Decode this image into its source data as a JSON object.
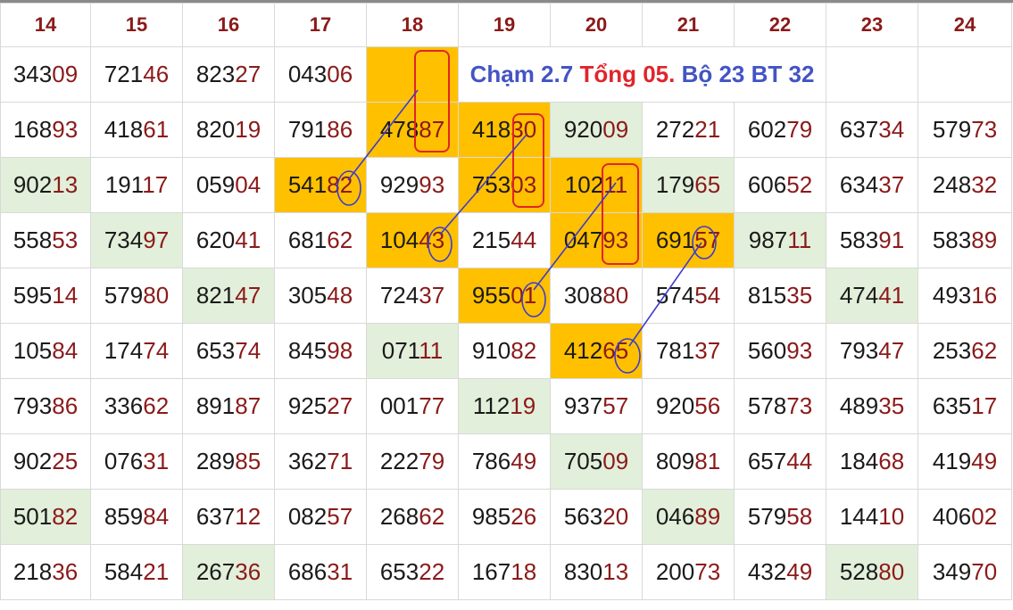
{
  "headers": [
    "14",
    "15",
    "16",
    "17",
    "18",
    "19",
    "20",
    "21",
    "22",
    "23",
    "24"
  ],
  "title": {
    "part1": "Chạm 2.7",
    "part2": "Tổng 05.",
    "part3": "Bộ 23 BT 32"
  },
  "rows": [
    [
      {
        "h": "343",
        "t": "09"
      },
      {
        "h": "721",
        "t": "46"
      },
      {
        "h": "823",
        "t": "27"
      },
      {
        "h": "043",
        "t": "06"
      },
      {
        "h": "",
        "t": "",
        "c": "o"
      },
      {
        "title": true
      },
      null,
      null,
      null,
      {
        "h": "",
        "t": ""
      },
      {
        "h": "",
        "t": ""
      }
    ],
    [
      {
        "h": "168",
        "t": "93"
      },
      {
        "h": "418",
        "t": "61"
      },
      {
        "h": "820",
        "t": "19"
      },
      {
        "h": "791",
        "t": "86"
      },
      {
        "h": "478",
        "t": "87",
        "c": "o"
      },
      {
        "h": "418",
        "t": "30",
        "c": "o"
      },
      {
        "h": "920",
        "t": "09",
        "c": "g"
      },
      {
        "h": "272",
        "t": "21"
      },
      {
        "h": "602",
        "t": "79"
      },
      {
        "h": "637",
        "t": "34"
      },
      {
        "h": "579",
        "t": "73"
      }
    ],
    [
      {
        "h": "902",
        "t": "13",
        "c": "g"
      },
      {
        "h": "191",
        "t": "17"
      },
      {
        "h": "059",
        "t": "04"
      },
      {
        "h": "541",
        "t": "82",
        "c": "o"
      },
      {
        "h": "929",
        "t": "93"
      },
      {
        "h": "753",
        "t": "03",
        "c": "o"
      },
      {
        "h": "102",
        "t": "11",
        "c": "o"
      },
      {
        "h": "179",
        "t": "65",
        "c": "g"
      },
      {
        "h": "606",
        "t": "52"
      },
      {
        "h": "634",
        "t": "37"
      },
      {
        "h": "248",
        "t": "32"
      }
    ],
    [
      {
        "h": "558",
        "t": "53"
      },
      {
        "h": "734",
        "t": "97",
        "c": "g"
      },
      {
        "h": "620",
        "t": "41"
      },
      {
        "h": "681",
        "t": "62"
      },
      {
        "h": "104",
        "t": "43",
        "c": "o"
      },
      {
        "h": "215",
        "t": "44"
      },
      {
        "h": "047",
        "t": "93",
        "c": "o"
      },
      {
        "h": "691",
        "t": "57",
        "c": "o"
      },
      {
        "h": "987",
        "t": "11",
        "c": "g"
      },
      {
        "h": "583",
        "t": "91"
      },
      {
        "h": "583",
        "t": "89"
      }
    ],
    [
      {
        "h": "595",
        "t": "14"
      },
      {
        "h": "579",
        "t": "80"
      },
      {
        "h": "821",
        "t": "47",
        "c": "g"
      },
      {
        "h": "305",
        "t": "48"
      },
      {
        "h": "724",
        "t": "37"
      },
      {
        "h": "955",
        "t": "01",
        "c": "o"
      },
      {
        "h": "308",
        "t": "80"
      },
      {
        "h": "574",
        "t": "54"
      },
      {
        "h": "815",
        "t": "35"
      },
      {
        "h": "474",
        "t": "41",
        "c": "g"
      },
      {
        "h": "493",
        "t": "16"
      }
    ],
    [
      {
        "h": "105",
        "t": "84"
      },
      {
        "h": "174",
        "t": "74"
      },
      {
        "h": "653",
        "t": "74"
      },
      {
        "h": "845",
        "t": "98"
      },
      {
        "h": "071",
        "t": "11",
        "c": "g"
      },
      {
        "h": "910",
        "t": "82"
      },
      {
        "h": "412",
        "t": "65",
        "c": "o"
      },
      {
        "h": "781",
        "t": "37"
      },
      {
        "h": "560",
        "t": "93"
      },
      {
        "h": "793",
        "t": "47"
      },
      {
        "h": "253",
        "t": "62"
      }
    ],
    [
      {
        "h": "793",
        "t": "86"
      },
      {
        "h": "336",
        "t": "62"
      },
      {
        "h": "891",
        "t": "87"
      },
      {
        "h": "925",
        "t": "27"
      },
      {
        "h": "001",
        "t": "77"
      },
      {
        "h": "112",
        "t": "19",
        "c": "g"
      },
      {
        "h": "937",
        "t": "57"
      },
      {
        "h": "920",
        "t": "56"
      },
      {
        "h": "578",
        "t": "73"
      },
      {
        "h": "489",
        "t": "35"
      },
      {
        "h": "635",
        "t": "17"
      }
    ],
    [
      {
        "h": "902",
        "t": "25"
      },
      {
        "h": "076",
        "t": "31"
      },
      {
        "h": "289",
        "t": "85"
      },
      {
        "h": "362",
        "t": "71"
      },
      {
        "h": "222",
        "t": "79"
      },
      {
        "h": "786",
        "t": "49"
      },
      {
        "h": "705",
        "t": "09",
        "c": "g"
      },
      {
        "h": "809",
        "t": "81"
      },
      {
        "h": "657",
        "t": "44"
      },
      {
        "h": "184",
        "t": "68"
      },
      {
        "h": "419",
        "t": "49"
      }
    ],
    [
      {
        "h": "501",
        "t": "82",
        "c": "g"
      },
      {
        "h": "859",
        "t": "84"
      },
      {
        "h": "637",
        "t": "12"
      },
      {
        "h": "082",
        "t": "57"
      },
      {
        "h": "268",
        "t": "62"
      },
      {
        "h": "985",
        "t": "26"
      },
      {
        "h": "563",
        "t": "20"
      },
      {
        "h": "046",
        "t": "89",
        "c": "g"
      },
      {
        "h": "579",
        "t": "58"
      },
      {
        "h": "144",
        "t": "10"
      },
      {
        "h": "406",
        "t": "02"
      }
    ],
    [
      {
        "h": "218",
        "t": "36"
      },
      {
        "h": "584",
        "t": "21"
      },
      {
        "h": "267",
        "t": "36",
        "c": "g"
      },
      {
        "h": "686",
        "t": "31"
      },
      {
        "h": "653",
        "t": "22"
      },
      {
        "h": "167",
        "t": "18"
      },
      {
        "h": "830",
        "t": "13"
      },
      {
        "h": "200",
        "t": "73"
      },
      {
        "h": "432",
        "t": "49"
      },
      {
        "h": "528",
        "t": "80",
        "c": "g"
      },
      {
        "h": "349",
        "t": "70"
      }
    ]
  ],
  "colors": {
    "header_text": "#8b1a1a",
    "tail_text": "#8b1a1a",
    "highlight_orange": "#ffc000",
    "highlight_green": "#e2efda",
    "annotation_red": "#e0242b",
    "annotation_blue": "#3d3dcc"
  }
}
